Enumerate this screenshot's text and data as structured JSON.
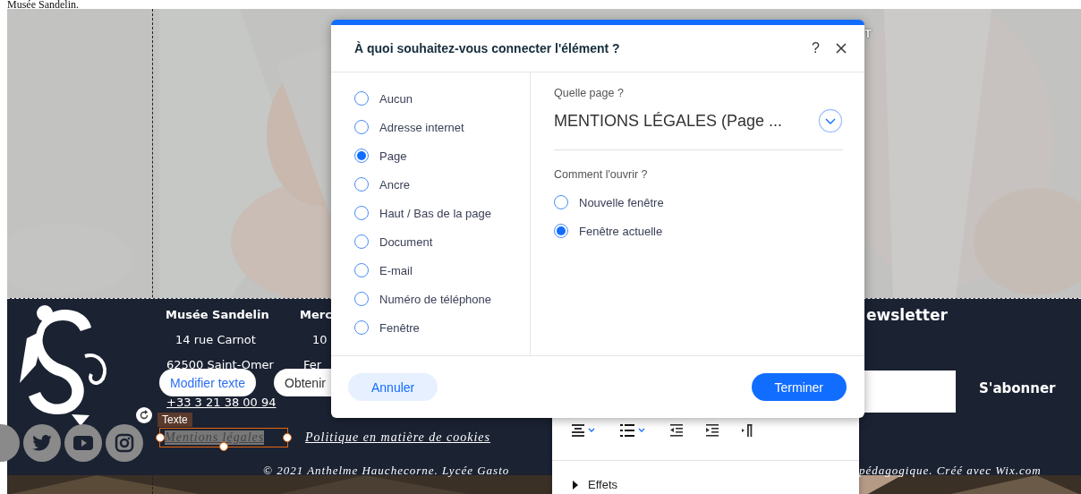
{
  "page_heading": "Musée Sandelin.",
  "nav_fragment": "T",
  "footer": {
    "address_column": [
      "Musée Sandelin",
      "14 rue Carnot",
      "62500 Saint-Omer",
      "+33 3 21 38 00 94"
    ],
    "hours_column": [
      "Merc",
      "10",
      "Fer"
    ],
    "newsletter_title": "ewsletter",
    "subscribe_button": "S'abonner",
    "links": [
      {
        "label": "Mentions légales",
        "selected": true
      },
      {
        "label": "Politique en matière de cookies",
        "selected": false
      }
    ],
    "copyright": [
      "© 2021 Anthelme Hauchecorne. Lycée Gasto",
      "pédagogique. Créé avec Wix.com"
    ]
  },
  "selection": {
    "tag": "Texte"
  },
  "floating_actions": [
    "Modifier texte",
    "Obtenir"
  ],
  "text_panel": {
    "section": "Effets",
    "expanded": false
  },
  "dialog": {
    "title": "À quoi souhaitez-vous connecter l'élément ?",
    "help": "?",
    "link_types": [
      {
        "label": "Aucun",
        "selected": false
      },
      {
        "label": "Adresse internet",
        "selected": false
      },
      {
        "label": "Page",
        "selected": true
      },
      {
        "label": "Ancre",
        "selected": false
      },
      {
        "label": "Haut / Bas de la page",
        "selected": false
      },
      {
        "label": "Document",
        "selected": false
      },
      {
        "label": "E-mail",
        "selected": false
      },
      {
        "label": "Numéro de téléphone",
        "selected": false
      },
      {
        "label": "Fenêtre",
        "selected": false
      }
    ],
    "page_label": "Quelle page ?",
    "page_value": "MENTIONS LÉGALES (Page ...",
    "open_label": "Comment l'ouvrir ?",
    "open_options": [
      {
        "label": "Nouvelle fenêtre",
        "selected": false
      },
      {
        "label": "Fenêtre actuelle",
        "selected": true
      }
    ],
    "cancel": "Annuler",
    "confirm": "Terminer"
  }
}
